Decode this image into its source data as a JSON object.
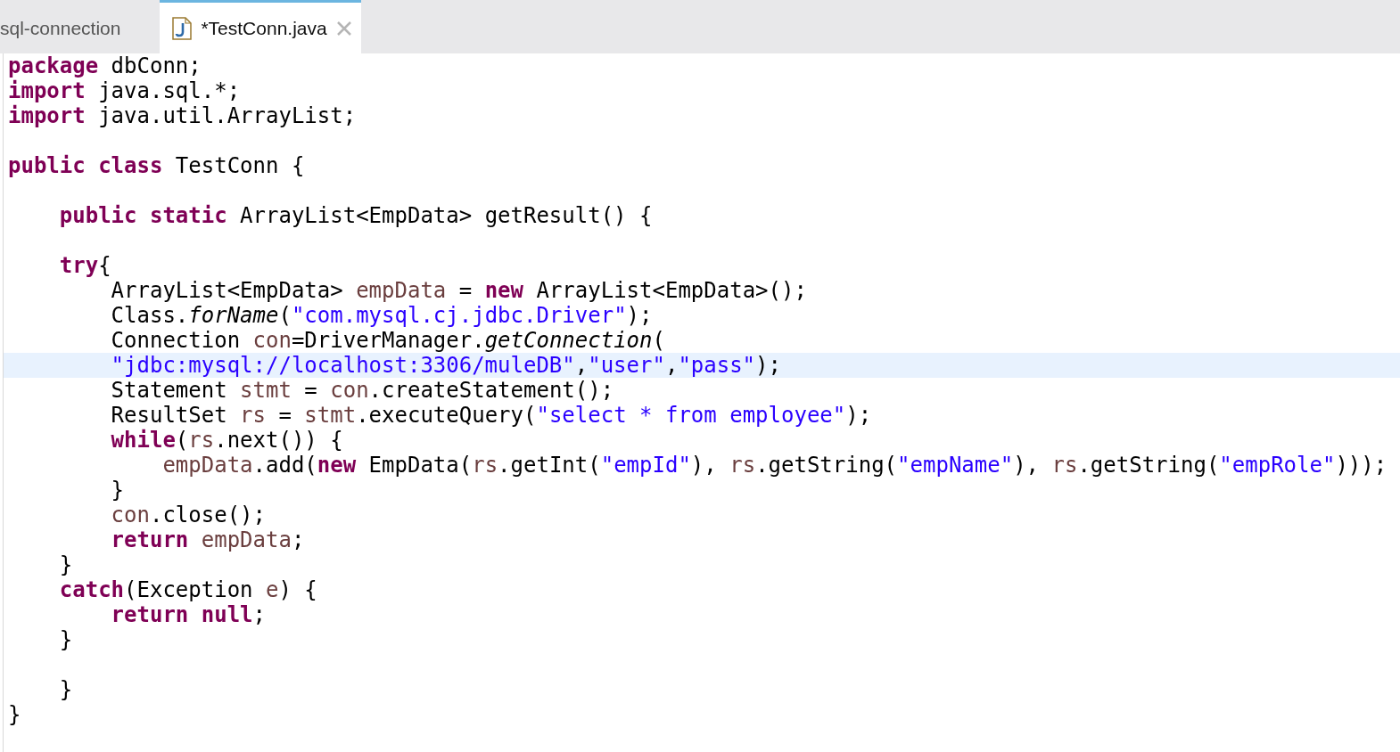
{
  "tabs": [
    {
      "label": "sql-connection",
      "selected": false,
      "icon": false
    },
    {
      "label": "*TestConn.java",
      "selected": true,
      "icon": true
    }
  ],
  "editor": {
    "lines": [
      {
        "highlighted": false,
        "tokens": [
          {
            "kind": "keyword",
            "text": "package"
          },
          {
            "kind": "plain",
            "text": " dbConn;"
          }
        ]
      },
      {
        "highlighted": false,
        "tokens": [
          {
            "kind": "keyword",
            "text": "import"
          },
          {
            "kind": "plain",
            "text": " java.sql.*;"
          }
        ]
      },
      {
        "highlighted": false,
        "tokens": [
          {
            "kind": "keyword",
            "text": "import"
          },
          {
            "kind": "plain",
            "text": " java.util.ArrayList;"
          }
        ]
      },
      {
        "highlighted": false
      },
      {
        "highlighted": false,
        "tokens": [
          {
            "kind": "keyword",
            "text": "public class"
          },
          {
            "kind": "plain",
            "text": " TestConn {"
          }
        ]
      },
      {
        "highlighted": false
      },
      {
        "highlighted": false,
        "tokens": [
          {
            "kind": "keyword",
            "text": "    public static"
          },
          {
            "kind": "plain",
            "text": " ArrayList<EmpData> getResult() {"
          }
        ]
      },
      {
        "highlighted": false
      },
      {
        "highlighted": false,
        "tokens": [
          {
            "kind": "keyword",
            "text": "    try"
          },
          {
            "kind": "plain",
            "text": "{"
          }
        ]
      },
      {
        "highlighted": false,
        "tokens": [
          {
            "kind": "plain",
            "text": "        ArrayList<EmpData> "
          },
          {
            "kind": "variable",
            "text": "empData"
          },
          {
            "kind": "plain",
            "text": " = "
          },
          {
            "kind": "keyword",
            "text": "new"
          },
          {
            "kind": "plain",
            "text": " ArrayList<EmpData>();"
          }
        ]
      },
      {
        "highlighted": false,
        "tokens": [
          {
            "kind": "plain",
            "text": "        Class."
          },
          {
            "kind": "static",
            "text": "forName"
          },
          {
            "kind": "plain",
            "text": "("
          },
          {
            "kind": "string",
            "text": "\"com.mysql.cj.jdbc.Driver\""
          },
          {
            "kind": "plain",
            "text": ");"
          }
        ]
      },
      {
        "highlighted": false,
        "tokens": [
          {
            "kind": "plain",
            "text": "        Connection "
          },
          {
            "kind": "variable",
            "text": "con"
          },
          {
            "kind": "plain",
            "text": "=DriverManager."
          },
          {
            "kind": "static",
            "text": "getConnection"
          },
          {
            "kind": "plain",
            "text": "("
          }
        ]
      },
      {
        "highlighted": true,
        "tokens": [
          {
            "kind": "string",
            "text": "        \"jdbc:mysql://localhost:3306/muleDB\""
          },
          {
            "kind": "plain",
            "text": ","
          },
          {
            "kind": "string",
            "text": "\"user\""
          },
          {
            "kind": "plain",
            "text": ","
          },
          {
            "kind": "string",
            "text": "\"pass\""
          },
          {
            "kind": "plain",
            "text": ");"
          }
        ]
      },
      {
        "highlighted": false,
        "tokens": [
          {
            "kind": "plain",
            "text": "        Statement "
          },
          {
            "kind": "variable",
            "text": "stmt"
          },
          {
            "kind": "plain",
            "text": " = "
          },
          {
            "kind": "variable",
            "text": "con"
          },
          {
            "kind": "plain",
            "text": ".createStatement();"
          }
        ]
      },
      {
        "highlighted": false,
        "tokens": [
          {
            "kind": "plain",
            "text": "        ResultSet "
          },
          {
            "kind": "variable",
            "text": "rs"
          },
          {
            "kind": "plain",
            "text": " = "
          },
          {
            "kind": "variable",
            "text": "stmt"
          },
          {
            "kind": "plain",
            "text": ".executeQuery("
          },
          {
            "kind": "string",
            "text": "\"select * from employee\""
          },
          {
            "kind": "plain",
            "text": ");"
          }
        ]
      },
      {
        "highlighted": false,
        "tokens": [
          {
            "kind": "keyword",
            "text": "        while"
          },
          {
            "kind": "plain",
            "text": "("
          },
          {
            "kind": "variable",
            "text": "rs"
          },
          {
            "kind": "plain",
            "text": ".next()) {"
          }
        ]
      },
      {
        "highlighted": false,
        "tokens": [
          {
            "kind": "variable",
            "text": "            empData"
          },
          {
            "kind": "plain",
            "text": ".add("
          },
          {
            "kind": "keyword",
            "text": "new"
          },
          {
            "kind": "plain",
            "text": " EmpData("
          },
          {
            "kind": "variable",
            "text": "rs"
          },
          {
            "kind": "plain",
            "text": ".getInt("
          },
          {
            "kind": "string",
            "text": "\"empId\""
          },
          {
            "kind": "plain",
            "text": "), "
          },
          {
            "kind": "variable",
            "text": "rs"
          },
          {
            "kind": "plain",
            "text": ".getString("
          },
          {
            "kind": "string",
            "text": "\"empName\""
          },
          {
            "kind": "plain",
            "text": "), "
          },
          {
            "kind": "variable",
            "text": "rs"
          },
          {
            "kind": "plain",
            "text": ".getString("
          },
          {
            "kind": "string",
            "text": "\"empRole\""
          },
          {
            "kind": "plain",
            "text": ")));"
          }
        ]
      },
      {
        "highlighted": false,
        "tokens": [
          {
            "kind": "plain",
            "text": "        }"
          }
        ]
      },
      {
        "highlighted": false,
        "tokens": [
          {
            "kind": "variable",
            "text": "        con"
          },
          {
            "kind": "plain",
            "text": ".close();"
          }
        ]
      },
      {
        "highlighted": false,
        "tokens": [
          {
            "kind": "keyword",
            "text": "        return "
          },
          {
            "kind": "variable",
            "text": "empData"
          },
          {
            "kind": "plain",
            "text": ";"
          }
        ]
      },
      {
        "highlighted": false,
        "tokens": [
          {
            "kind": "plain",
            "text": "    }"
          }
        ]
      },
      {
        "highlighted": false,
        "tokens": [
          {
            "kind": "keyword",
            "text": "    catch"
          },
          {
            "kind": "plain",
            "text": "(Exception "
          },
          {
            "kind": "variable",
            "text": "e"
          },
          {
            "kind": "plain",
            "text": ") {"
          }
        ]
      },
      {
        "highlighted": false,
        "tokens": [
          {
            "kind": "keyword",
            "text": "        return null"
          },
          {
            "kind": "plain",
            "text": ";"
          }
        ]
      },
      {
        "highlighted": false,
        "tokens": [
          {
            "kind": "plain",
            "text": "    }"
          }
        ]
      },
      {
        "highlighted": false
      },
      {
        "highlighted": false,
        "tokens": [
          {
            "kind": "plain",
            "text": "    }"
          }
        ]
      },
      {
        "highlighted": false,
        "tokens": [
          {
            "kind": "plain",
            "text": "}"
          }
        ]
      }
    ]
  }
}
